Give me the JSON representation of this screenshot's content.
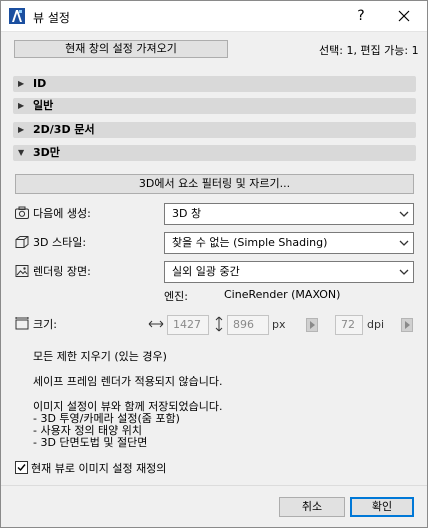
{
  "window": {
    "title": "뷰 설정",
    "help_label": "?",
    "close_icon": "close-icon",
    "app_icon": "archicad-icon"
  },
  "top": {
    "get_current_view_button": "현재 창의 설정 가져오기",
    "selection_info": "선택: 1, 편집 가능: 1"
  },
  "sections": [
    {
      "label": "ID",
      "expanded": false
    },
    {
      "label": "일반",
      "expanded": false
    },
    {
      "label": "2D/3D 문서",
      "expanded": false
    },
    {
      "label": "3D만",
      "expanded": true
    }
  ],
  "threed": {
    "filter_button": "3D에서 요소 필터링 및 자르기...",
    "create_in_label": "다음에 생성:",
    "create_in_value": "3D 창",
    "style_label": "3D 스타일:",
    "style_value": "찾을 수 없는 (Simple Shading)",
    "scene_label": "렌더링 장면:",
    "scene_value": "실외 일광 중간",
    "engine_label": "엔진:",
    "engine_value": "CineRender (MAXON)",
    "size_label": "크기:",
    "width_value": "1427",
    "height_value": "896",
    "px_unit": "px",
    "dpi_value": "72",
    "dpi_unit": "dpi"
  },
  "notes": {
    "clear_limits": "모든 제한 지우기 (있는 경우)",
    "safe_frame": "세이프 프레임 렌더가 적용되지 않습니다.",
    "saved_intro": "이미지 설정이 뷰와 함께 저장되었습니다.",
    "saved_items": [
      "- 3D 투영/카메라 설정(줌 포함)",
      "- 사용자 정의 태양 위치",
      "- 3D 단면도법 및 절단면"
    ]
  },
  "override": {
    "label": "현재 뷰로 이미지 설정 재정의",
    "checked": true
  },
  "footer": {
    "cancel_label": "취소",
    "ok_label": "확인"
  },
  "colors": {
    "accent": "#0078d7",
    "section_bg": "#d9d9d9",
    "dialog_bg": "#f0f0f0"
  }
}
